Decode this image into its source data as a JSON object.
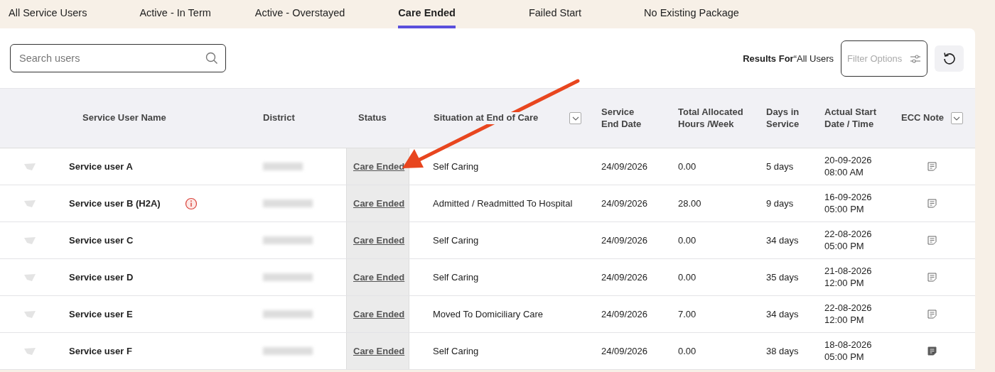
{
  "tabs": [
    {
      "label": "All Service Users",
      "selected": false
    },
    {
      "label": "Active - In Term",
      "selected": false
    },
    {
      "label": "Active - Overstayed",
      "selected": false
    },
    {
      "label": "Care Ended",
      "selected": true
    },
    {
      "label": "Failed Start",
      "selected": false
    },
    {
      "label": "No Existing Package",
      "selected": false
    }
  ],
  "toolbar": {
    "search": {
      "placeholder": "Search users"
    },
    "results_for": "**Results For**“All Users",
    "filter": {
      "placeholder": "Filter Options"
    }
  },
  "table": {
    "columns": [
      {
        "label": "Service User Name",
        "has_menu": false
      },
      {
        "label": "District",
        "has_menu": false
      },
      {
        "label": "Status",
        "has_menu": false
      },
      {
        "label": "Situation at End of Care",
        "has_menu": true
      },
      {
        "label": "Service End Date",
        "has_menu": false
      },
      {
        "label": "Total Allocated Hours /Week",
        "has_menu": false
      },
      {
        "label": "Days in Service",
        "has_menu": false
      },
      {
        "label": "Actual Start Date / Time",
        "has_menu": false
      },
      {
        "label": "ECC Note",
        "has_menu": true
      }
    ],
    "rows": [
      {
        "name": "Service user A",
        "alert": false,
        "status": "Care Ended",
        "situation": "Self Caring",
        "end_date": "24/09/2026",
        "hours": "0.00",
        "days": "5 days",
        "start_date": "20-09-2026",
        "start_time": "08:00 AM",
        "note_filled": false
      },
      {
        "name": "Service user B (H2A)",
        "alert": true,
        "status": "Care Ended",
        "situation": "Admitted / Readmitted To Hospital",
        "end_date": "24/09/2026",
        "hours": "28.00",
        "days": "9 days",
        "start_date": "16-09-2026",
        "start_time": "05:00 PM",
        "note_filled": false
      },
      {
        "name": "Service user C",
        "alert": false,
        "status": "Care Ended",
        "situation": "Self Caring",
        "end_date": "24/09/2026",
        "hours": "0.00",
        "days": "34 days",
        "start_date": "22-08-2026",
        "start_time": "05:00 PM",
        "note_filled": false
      },
      {
        "name": "Service user D",
        "alert": false,
        "status": "Care Ended",
        "situation": "Self Caring",
        "end_date": "24/09/2026",
        "hours": "0.00",
        "days": "35 days",
        "start_date": "21-08-2026",
        "start_time": "12:00 PM",
        "note_filled": false
      },
      {
        "name": "Service user E",
        "alert": false,
        "status": "Care Ended",
        "situation": "Moved To Domiciliary Care",
        "end_date": "24/09/2026",
        "hours": "7.00",
        "days": "34 days",
        "start_date": "22-08-2026",
        "start_time": "12:00 PM",
        "note_filled": false
      },
      {
        "name": "Service user F",
        "alert": false,
        "status": "Care Ended",
        "situation": "Self Caring",
        "end_date": "24/09/2026",
        "hours": "0.00",
        "days": "38 days",
        "start_date": "18-08-2026",
        "start_time": "05:00 PM",
        "note_filled": true
      }
    ]
  }
}
